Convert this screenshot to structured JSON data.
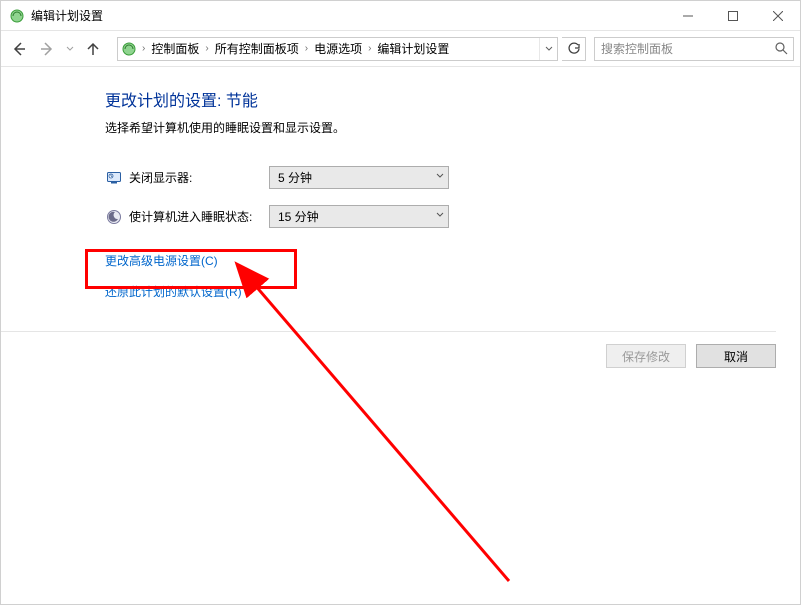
{
  "window": {
    "title": "编辑计划设置"
  },
  "breadcrumb": {
    "items": [
      "控制面板",
      "所有控制面板项",
      "电源选项",
      "编辑计划设置"
    ]
  },
  "search": {
    "placeholder": "搜索控制面板"
  },
  "page": {
    "title": "更改计划的设置: 节能",
    "subtitle": "选择希望计算机使用的睡眠设置和显示设置。"
  },
  "settings": {
    "display_off": {
      "label": "关闭显示器:",
      "value": "5 分钟"
    },
    "sleep": {
      "label": "使计算机进入睡眠状态:",
      "value": "15 分钟"
    }
  },
  "links": {
    "advanced": "更改高级电源设置(C)",
    "restore": "还原此计划的默认设置(R)"
  },
  "buttons": {
    "save": "保存修改",
    "cancel": "取消"
  }
}
